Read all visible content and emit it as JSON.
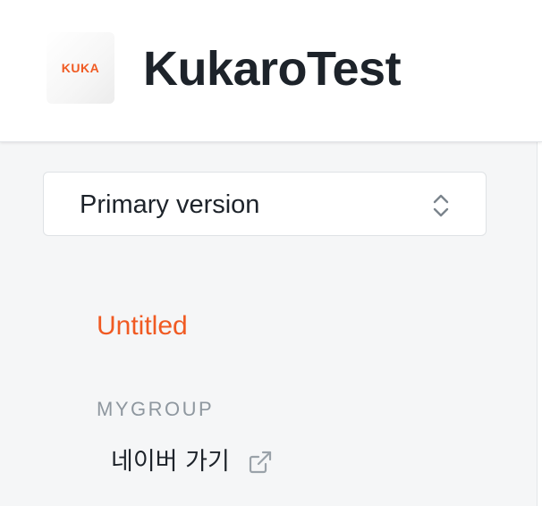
{
  "header": {
    "logo_text": "KUKA",
    "site_title": "KukaroTest"
  },
  "colors": {
    "accent": "#f05a22",
    "text_primary": "#1d232a",
    "text_muted": "#8e979f",
    "sidebar_bg": "#f5f6f7"
  },
  "sidebar": {
    "version_select": {
      "selected": "Primary version",
      "icon": "chevron-up-down-icon"
    },
    "nav": {
      "active_item": "Untitled",
      "groups": [
        {
          "label": "MYGROUP",
          "items": [
            {
              "label": "네이버 가기",
              "icon": "external-link-icon"
            }
          ]
        }
      ]
    }
  }
}
